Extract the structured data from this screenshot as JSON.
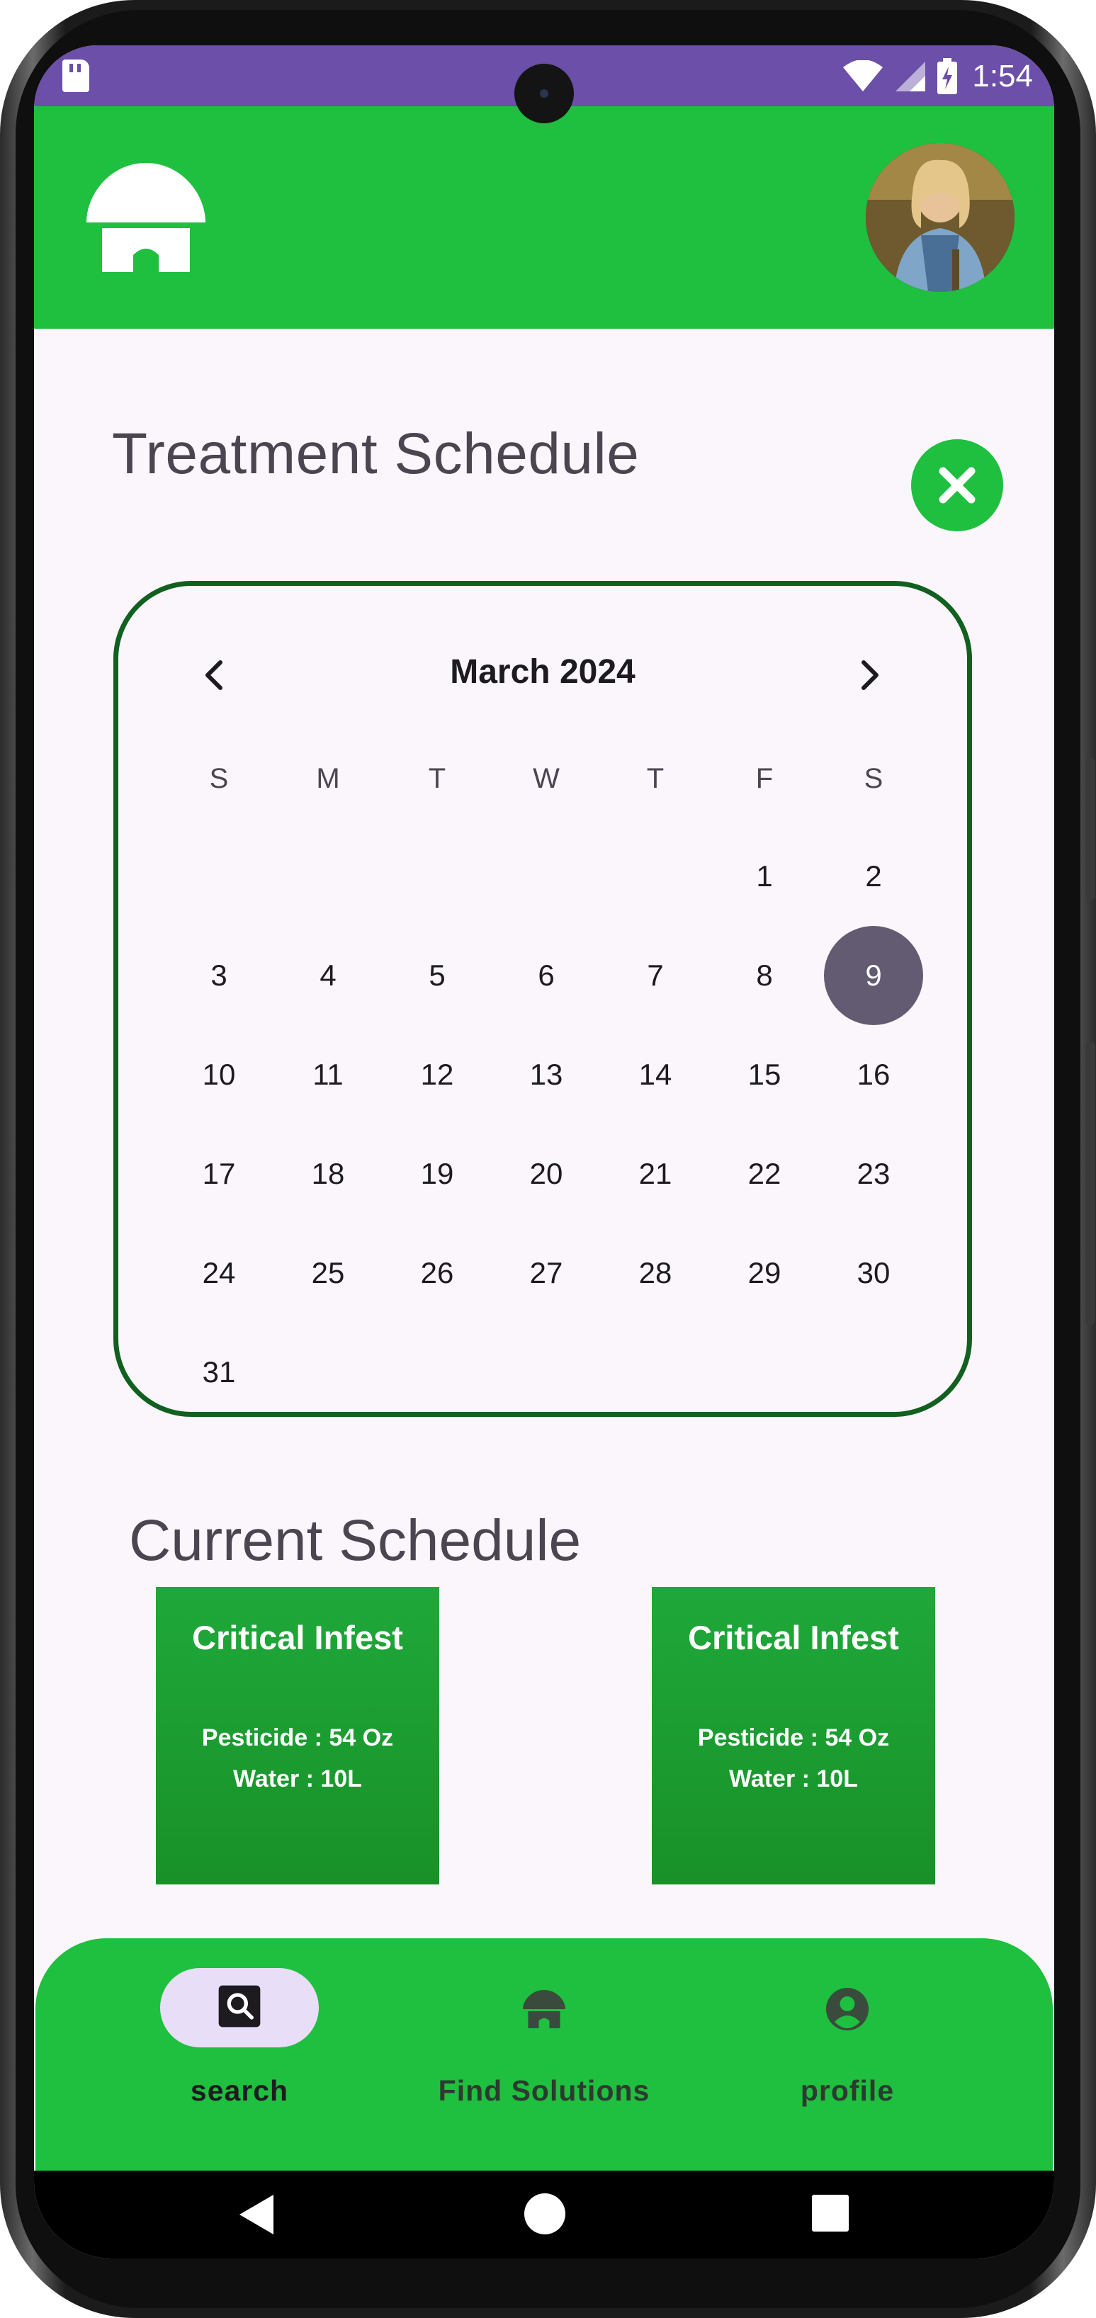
{
  "status_bar": {
    "time": "1:54"
  },
  "page": {
    "title": "Treatment Schedule"
  },
  "calendar": {
    "month_label": "March 2024",
    "weekdays": [
      "S",
      "M",
      "T",
      "W",
      "T",
      "F",
      "S"
    ],
    "days": [
      "1",
      "2",
      "3",
      "4",
      "5",
      "6",
      "7",
      "8",
      "9",
      "10",
      "11",
      "12",
      "13",
      "14",
      "15",
      "16",
      "17",
      "18",
      "19",
      "20",
      "21",
      "22",
      "23",
      "24",
      "25",
      "26",
      "27",
      "28",
      "29",
      "30",
      "31"
    ],
    "first_weekday_index": 5,
    "selected_day": "9"
  },
  "schedule": {
    "title": "Current Schedule",
    "cards": [
      {
        "title": "Critical Infest",
        "line1": "Pesticide : 54 Oz",
        "line2": "Water : 10L"
      },
      {
        "title": "Critical Infest",
        "line1": "Pesticide : 54 Oz",
        "line2": "Water : 10L"
      }
    ]
  },
  "bottom_nav": {
    "items": [
      {
        "label": "search",
        "icon": "search-icon",
        "active": true
      },
      {
        "label": "Find Solutions",
        "icon": "house-icon",
        "active": false
      },
      {
        "label": "profile",
        "icon": "account-circle-icon",
        "active": false
      }
    ]
  },
  "colors": {
    "brand_green": "#1fbf3f",
    "calendar_border": "#11601f",
    "selected_day": "#625b71",
    "status_bar": "#6b4fa8",
    "nav_pill": "#e8def8"
  }
}
